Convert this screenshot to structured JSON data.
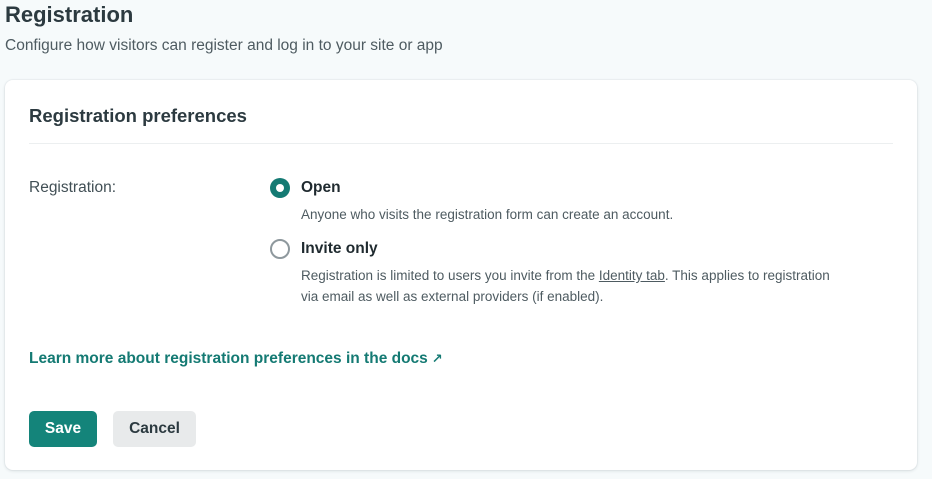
{
  "header": {
    "title": "Registration",
    "subtitle": "Configure how visitors can register and log in to your site or app"
  },
  "card": {
    "title": "Registration preferences",
    "field_label": "Registration:",
    "options": [
      {
        "label": "Open",
        "selected": true,
        "description": "Anyone who visits the registration form can create an account."
      },
      {
        "label": "Invite only",
        "selected": false,
        "description_before_link": "Registration is limited to users you invite from the ",
        "description_link": "Identity tab",
        "description_after_link": ". This applies to registration",
        "description_line2": "via email as well as external providers (if enabled)."
      }
    ],
    "docs_link": {
      "label": "Learn more about registration preferences in the docs",
      "icon": "external-arrow-icon"
    },
    "buttons": {
      "save": "Save",
      "cancel": "Cancel"
    }
  },
  "colors": {
    "accent": "#147a73",
    "save_button": "#14847a",
    "cancel_button": "#e8eaeb",
    "background": "#f6fafb"
  }
}
